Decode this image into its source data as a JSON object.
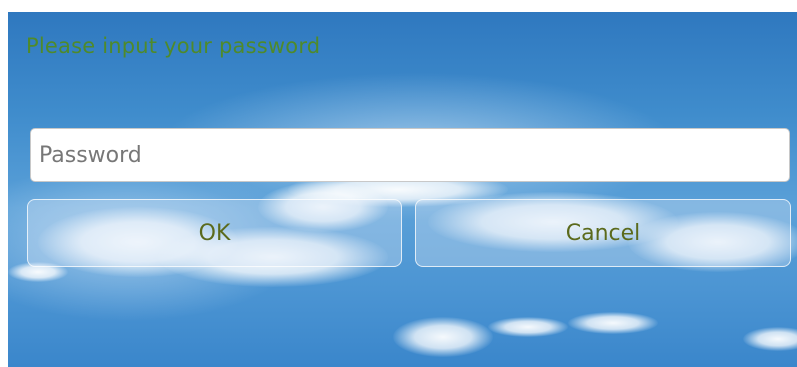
{
  "dialog": {
    "title": "Please input your password",
    "password_placeholder": "Password",
    "password_value": "",
    "ok_label": "OK",
    "cancel_label": "Cancel"
  },
  "colors": {
    "title_text": "#4f8a2a",
    "button_text": "#5b6a1c",
    "sky": "#3f8ccc"
  }
}
